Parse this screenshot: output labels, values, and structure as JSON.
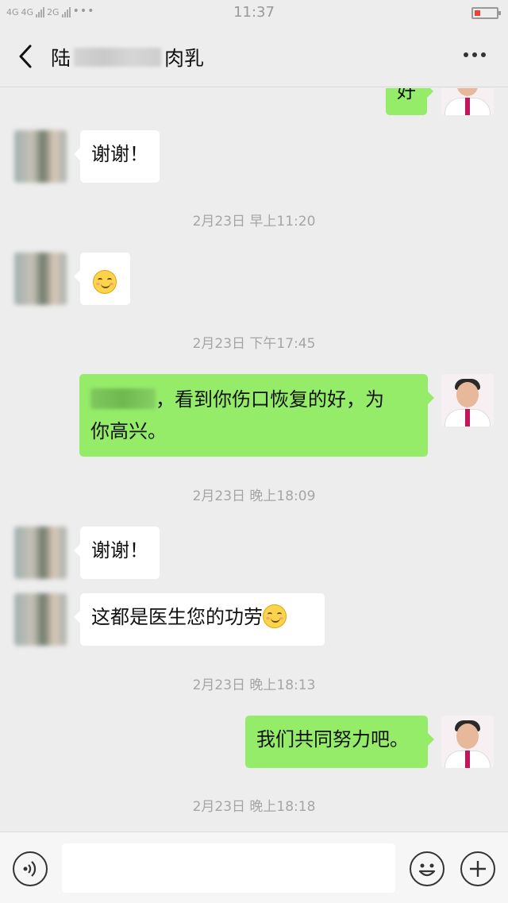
{
  "status_bar": {
    "network_1": "4G",
    "network_2": "4G",
    "network_3": "2G",
    "time": "11:37",
    "icons": [
      "signal-icon",
      "wifi-dots-icon",
      "battery-low-icon"
    ]
  },
  "header": {
    "title_prefix": "陆",
    "title_suffix": "肉乳",
    "icons": [
      "back-chevron-icon",
      "more-dots-icon"
    ]
  },
  "messages": [
    {
      "side": "right",
      "type": "text",
      "text": "好"
    },
    {
      "side": "left",
      "type": "text",
      "text": "谢谢！"
    },
    {
      "type": "timestamp",
      "text": "2月23日 早上11:20"
    },
    {
      "side": "left",
      "type": "emoji",
      "emoji": "smile-emoji"
    },
    {
      "type": "timestamp",
      "text": "2月23日 下午17:45"
    },
    {
      "side": "right",
      "type": "text",
      "line1": "，看到你伤口恢复的好，为",
      "line2": "你高兴。"
    },
    {
      "type": "timestamp",
      "text": "2月23日 晚上18:09"
    },
    {
      "side": "left",
      "type": "text",
      "text": "谢谢！"
    },
    {
      "side": "left",
      "type": "text",
      "text": "这都是医生您的功劳"
    },
    {
      "type": "timestamp",
      "text": "2月23日 晚上18:13"
    },
    {
      "side": "right",
      "type": "text",
      "text": "我们共同努力吧。"
    },
    {
      "type": "timestamp",
      "text": "2月23日 晚上18:18"
    }
  ],
  "input_bar": {
    "placeholder": "",
    "icons": [
      "voice-icon",
      "emoji-icon",
      "plus-icon"
    ]
  },
  "colors": {
    "background": "#ededed",
    "bubble_sent": "#95ec69",
    "bubble_received": "#ffffff",
    "timestamp": "#a5a5a5"
  }
}
